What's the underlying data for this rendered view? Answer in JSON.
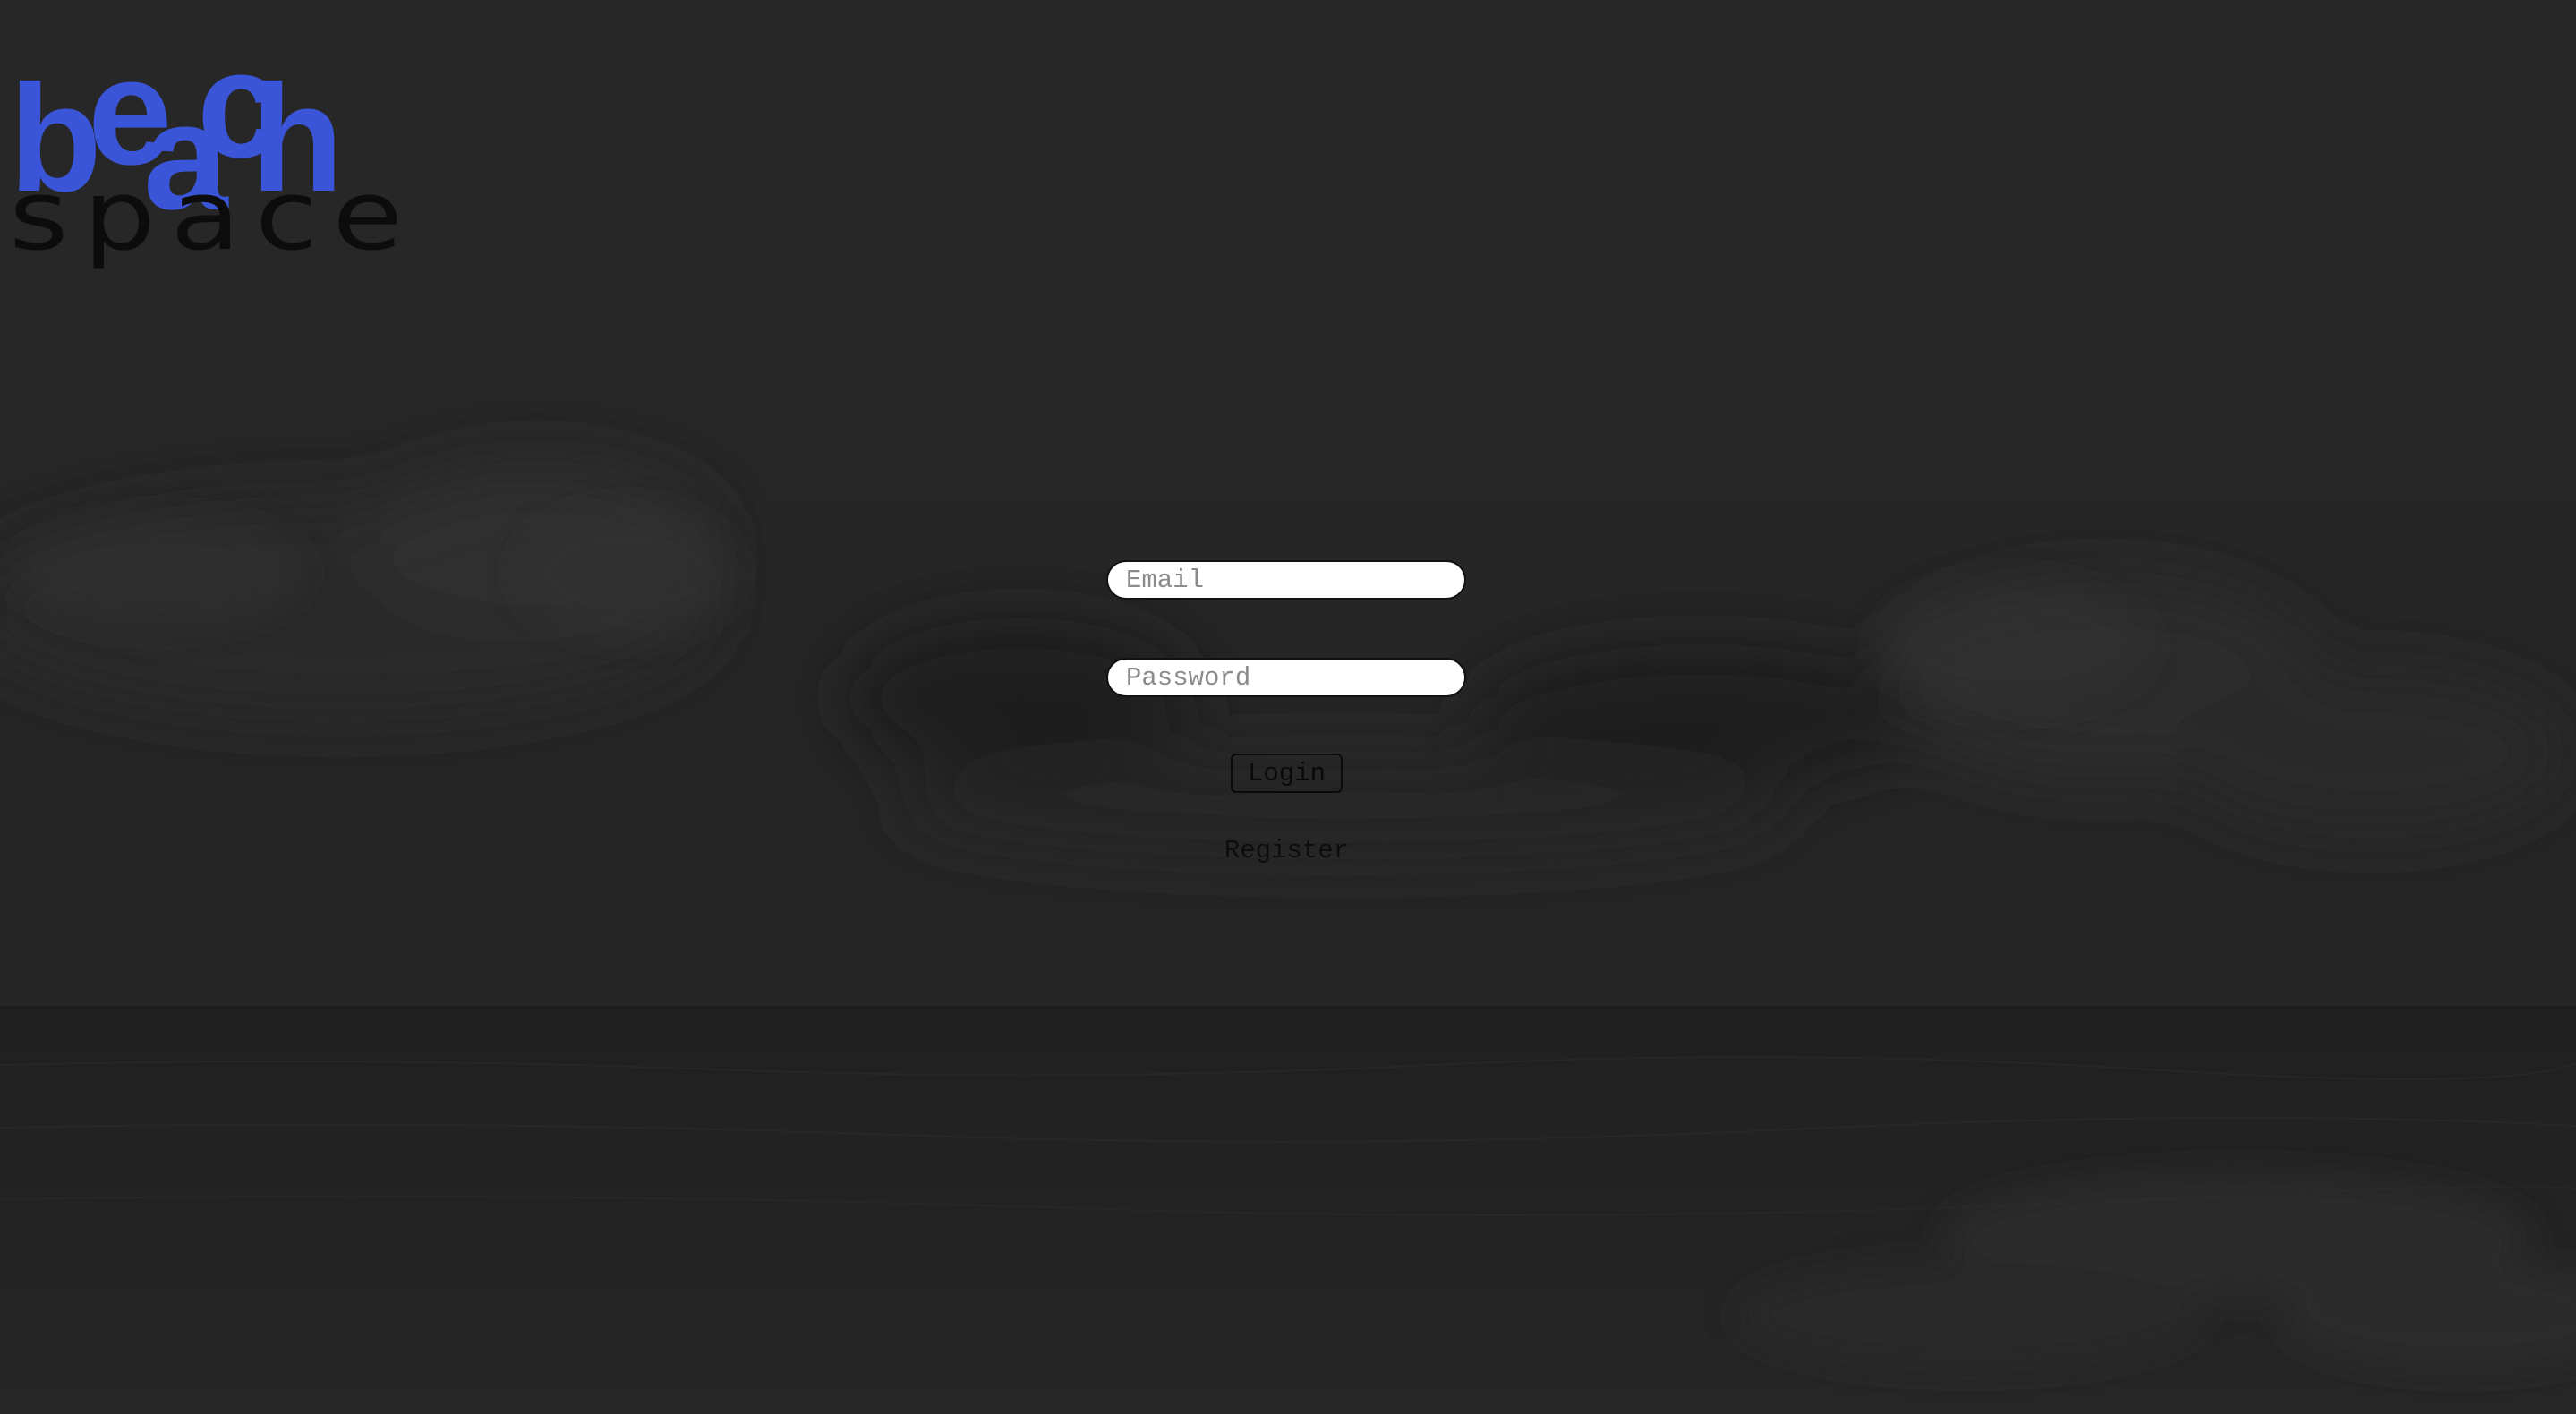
{
  "logo": {
    "word": "beach",
    "sub": "space",
    "color": "#3a55d8"
  },
  "login_form": {
    "email_placeholder": "Email",
    "password_placeholder": "Password",
    "login_label": "Login",
    "register_label": "Register"
  },
  "colors": {
    "background": "#252525",
    "logo_blue": "#3a55d8"
  }
}
